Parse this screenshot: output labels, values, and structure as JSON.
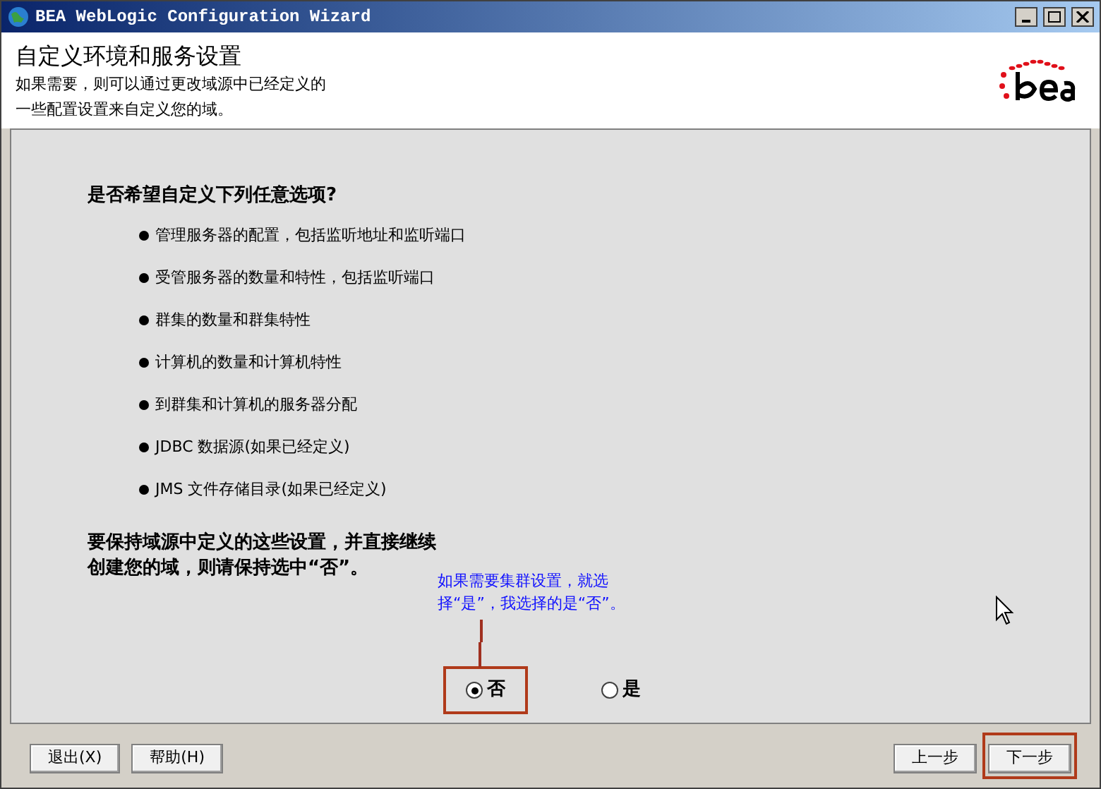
{
  "window": {
    "title": "BEA WebLogic Configuration Wizard"
  },
  "header": {
    "title": "自定义环境和服务设置",
    "subtitle_lines": [
      "如果需要，则可以通过更改域源中已经定义的",
      "一些配置设置来自定义您的域。"
    ]
  },
  "question": "是否希望自定义下列任意选项?",
  "items": [
    "管理服务器的配置，包括监听地址和监听端口",
    "受管服务器的数量和特性，包括监听端口",
    "群集的数量和群集特性",
    "计算机的数量和计算机特性",
    "到群集和计算机的服务器分配",
    "JDBC 数据源(如果已经定义)",
    "JMS 文件存储目录(如果已经定义)"
  ],
  "instruction_lines": [
    "要保持域源中定义的这些设置，并直接继续",
    "创建您的域，则请保持选中“否”。"
  ],
  "annotation": {
    "lines": [
      "如果需要集群设置，就选",
      "择“是”，我选择的是“否”。"
    ]
  },
  "options": [
    {
      "label": "否",
      "selected": true,
      "highlighted": true
    },
    {
      "label": "是",
      "selected": false,
      "highlighted": false
    }
  ],
  "left_buttons": [
    {
      "label": "退出(X)",
      "highlighted": false
    },
    {
      "label": "帮助(H)",
      "highlighted": false
    }
  ],
  "right_buttons": [
    {
      "label": "上一步",
      "highlighted": false
    },
    {
      "label": "下一步",
      "highlighted": true
    }
  ]
}
